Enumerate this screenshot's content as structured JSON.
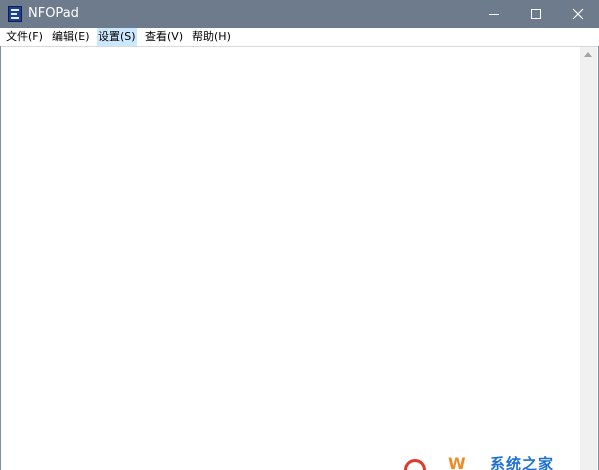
{
  "window": {
    "title": "NFOPad",
    "icon": "nfo-document-icon",
    "title_bar_color": "#6d7b8d"
  },
  "controls": {
    "minimize_icon": "minimize-icon",
    "maximize_icon": "maximize-icon",
    "close_icon": "close-icon"
  },
  "menu": {
    "items": [
      {
        "label": "文件(F)"
      },
      {
        "label": "编辑(E)"
      },
      {
        "label": "设置(S)",
        "active": true
      },
      {
        "label": "查看(V)"
      },
      {
        "label": "帮助(H)"
      }
    ],
    "active_color": "#cce8ff"
  },
  "editor": {
    "content": ""
  },
  "watermark": {
    "logo_w": "W",
    "text": "系统之家"
  }
}
